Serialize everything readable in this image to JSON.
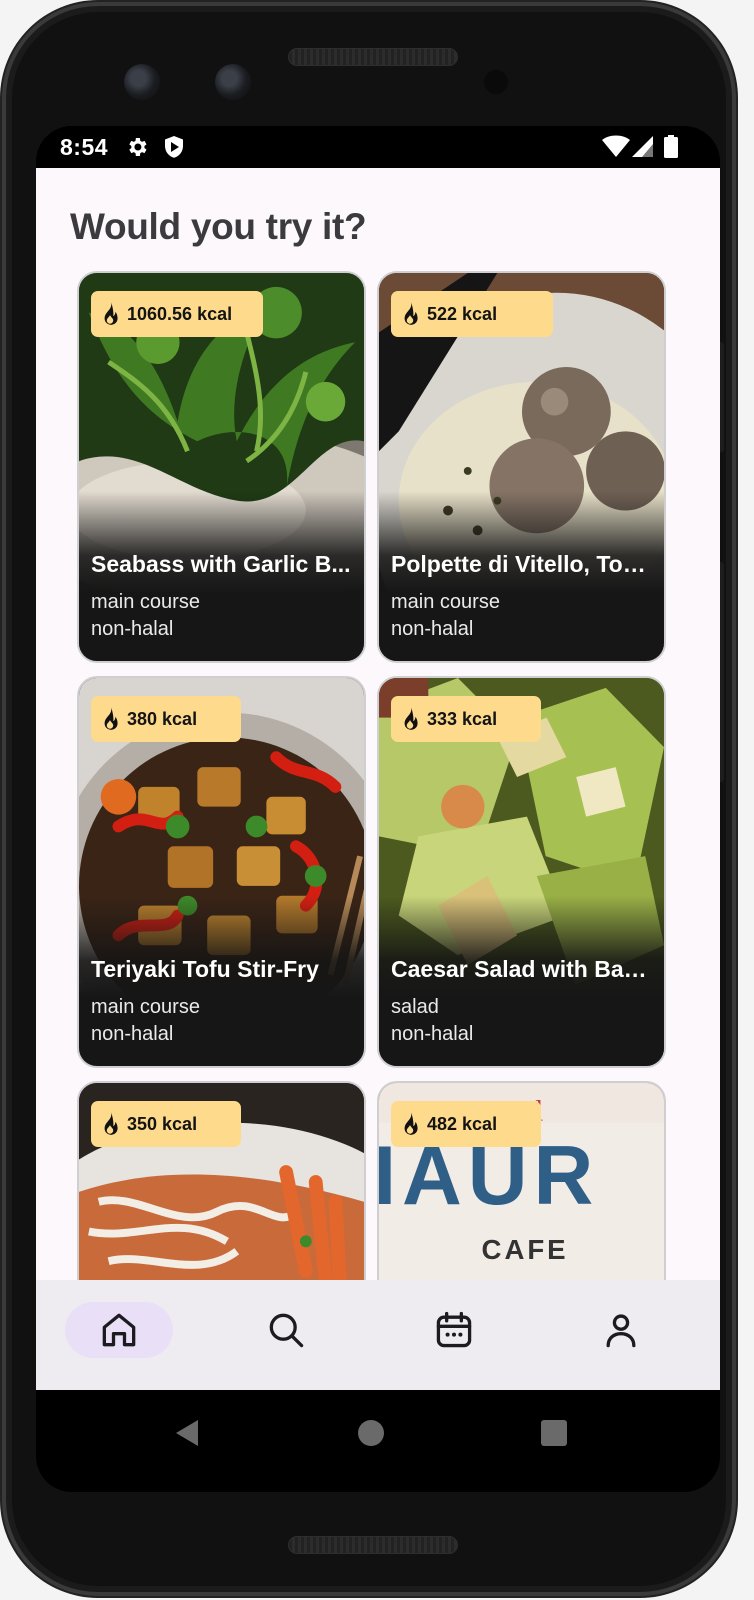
{
  "status_bar": {
    "time": "8:54",
    "icons": [
      "gear-icon",
      "shield-icon",
      "wifi-icon",
      "signal-icon",
      "battery-icon"
    ]
  },
  "page": {
    "title": "Would you try it?"
  },
  "cards": [
    {
      "kcal": "1060.56 kcal",
      "title": "Seabass with Garlic B...",
      "category": "main course",
      "diet": "non-halal"
    },
    {
      "kcal": "522 kcal",
      "title": "Polpette di Vitello, Ton...",
      "category": "main course",
      "diet": "non-halal"
    },
    {
      "kcal": "380 kcal",
      "title": "Teriyaki Tofu Stir-Fry",
      "category": "main course",
      "diet": "non-halal"
    },
    {
      "kcal": "333 kcal",
      "title": "Caesar Salad with Bag...",
      "category": "salad",
      "diet": "non-halal"
    },
    {
      "kcal": "350 kcal",
      "title": "",
      "category": "",
      "diet": ""
    },
    {
      "kcal": "482 kcal",
      "title": "",
      "category": "",
      "diet": ""
    }
  ],
  "nav": {
    "items": [
      "home-icon",
      "search-icon",
      "calendar-icon",
      "profile-icon"
    ],
    "active": "home-icon"
  },
  "colors": {
    "kcal_badge": "#fedb8c",
    "nav_active": "#e9dff6",
    "background": "#fdf8fc"
  }
}
